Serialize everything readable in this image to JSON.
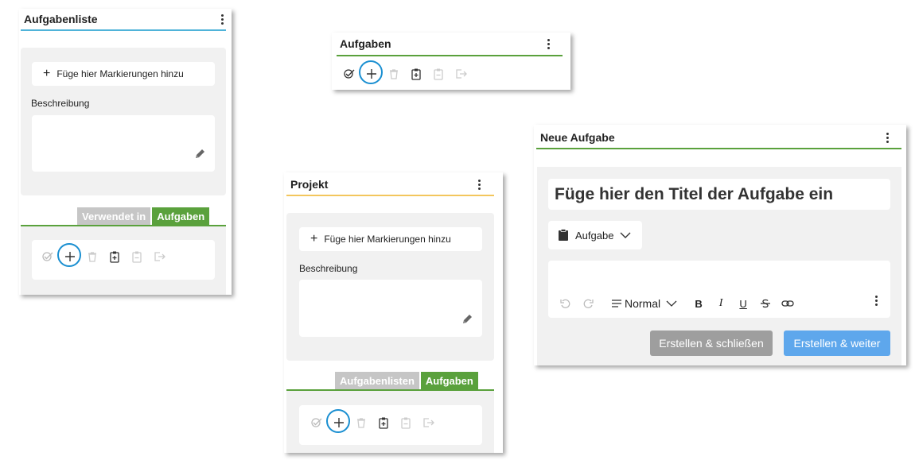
{
  "panel_tasklist": {
    "title": "Aufgabenliste",
    "tags_button": "Füge hier Markierungen hinzu",
    "description_label": "Beschreibung",
    "tabs": [
      "Verwendet in",
      "Aufgaben"
    ]
  },
  "panel_tasks": {
    "title": "Aufgaben"
  },
  "panel_project": {
    "title": "Projekt",
    "tags_button": "Füge hier Markierungen hinzu",
    "description_label": "Beschreibung",
    "tabs": [
      "Aufgabenlisten",
      "Aufgaben"
    ]
  },
  "panel_new_task": {
    "title": "Neue Aufgabe",
    "title_placeholder": "Füge hier den Titel der Aufgabe ein",
    "type_select": "Aufgabe",
    "format_select": "Normal",
    "bold": "B",
    "italic": "I",
    "underline": "U",
    "create_close": "Erstellen & schließen",
    "create_continue": "Erstellen & weiter"
  },
  "colors": {
    "tasklist_accent": "#4fb3d9",
    "tasks_accent": "#5aa13c",
    "project_accent": "#f3c65d",
    "highlight_ring": "#1a8fd1",
    "button_gray": "#9e9e9e",
    "button_blue": "#5ea7ec"
  },
  "icons": [
    "check-all-icon",
    "add-icon",
    "delete-icon",
    "clipboard-add-icon",
    "clipboard-remove-icon",
    "export-icon",
    "pencil-icon",
    "clipboard-icon",
    "chevron-down-icon",
    "undo-icon",
    "redo-icon",
    "paragraph-icon",
    "strikethrough-icon",
    "link-icon"
  ]
}
